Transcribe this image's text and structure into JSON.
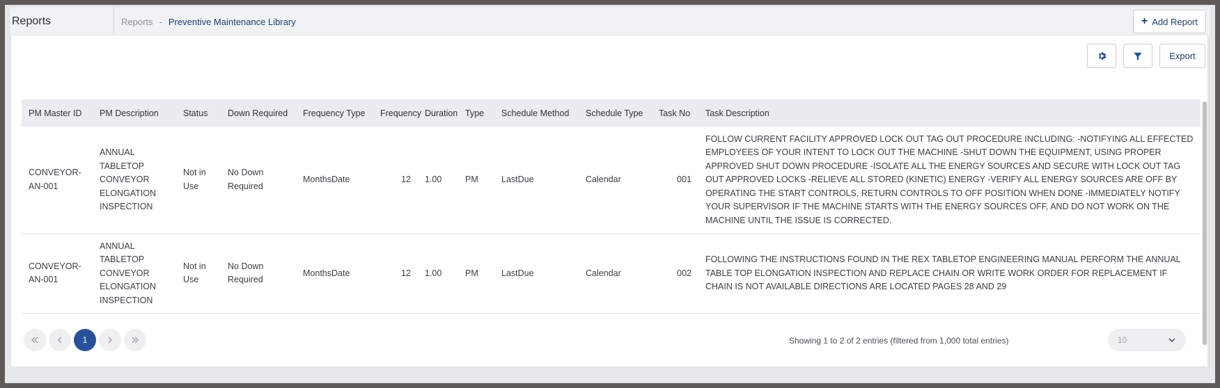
{
  "header": {
    "app_title": "Reports",
    "breadcrumb_root": "Reports",
    "breadcrumb_separator": "-",
    "breadcrumb_current": "Preventive Maintenance Library",
    "add_report_label": "Add Report"
  },
  "toolbar": {
    "export_label": "Export",
    "icons": [
      "gear-icon",
      "filter-icon"
    ]
  },
  "table": {
    "columns": [
      "PM Master ID",
      "PM Description",
      "Status",
      "Down Required",
      "Frequency Type",
      "Frequency",
      "Duration",
      "Type",
      "Schedule Method",
      "Schedule Type",
      "Task No",
      "Task Description"
    ],
    "rows": [
      {
        "pm_master_id": "CONVEYOR-AN-001",
        "pm_description": "ANNUAL TABLETOP CONVEYOR ELONGATION INSPECTION",
        "status": "Not in Use",
        "down_required": "No Down Required",
        "frequency_type": "MonthsDate",
        "frequency": "12",
        "duration": "1.00",
        "type": "PM",
        "schedule_method": "LastDue",
        "schedule_type": "Calendar",
        "task_no": "001",
        "task_description": "FOLLOW CURRENT FACILITY APPROVED LOCK OUT TAG OUT PROCEDURE INCLUDING: -NOTIFYING ALL EFFECTED EMPLOYEES OF YOUR INTENT TO LOCK OUT THE MACHINE -SHUT DOWN THE EQUIPMENT, USING PROPER APPROVED SHUT DOWN PROCEDURE -ISOLATE ALL THE ENERGY SOURCES AND SECURE WITH LOCK OUT TAG OUT APPROVED LOCKS -RELIEVE ALL STORED (KINETIC) ENERGY -VERIFY ALL ENERGY SOURCES ARE OFF BY OPERATING THE START CONTROLS, RETURN CONTROLS TO OFF POSITION WHEN DONE -IMMEDIATELY NOTIFY YOUR SUPERVISOR IF THE MACHINE STARTS WITH THE ENERGY SOURCES OFF, AND DO NOT WORK ON THE MACHINE UNTIL THE ISSUE IS CORRECTED."
      },
      {
        "pm_master_id": "CONVEYOR-AN-001",
        "pm_description": "ANNUAL TABLETOP CONVEYOR ELONGATION INSPECTION",
        "status": "Not in Use",
        "down_required": "No Down Required",
        "frequency_type": "MonthsDate",
        "frequency": "12",
        "duration": "1.00",
        "type": "PM",
        "schedule_method": "LastDue",
        "schedule_type": "Calendar",
        "task_no": "002",
        "task_description": "FOLLOWING THE INSTRUCTIONS FOUND IN THE REX TABLETOP ENGINEERING MANUAL PERFORM THE ANNUAL TABLE TOP ELONGATION INSPECTION AND REPLACE CHAIN OR WRITE WORK ORDER FOR REPLACEMENT IF CHAIN IS NOT AVAILABLE DIRECTIONS ARE LOCATED PAGES 28 AND 29"
      }
    ]
  },
  "pagination": {
    "current_page": "1",
    "info": "Showing 1 to 2 of 2 entries (filtered from 1,000 total entries)",
    "page_size": "10",
    "icons": [
      "first-page-icon",
      "prev-page-icon",
      "next-page-icon",
      "last-page-icon",
      "chevron-down-icon"
    ]
  },
  "colors": {
    "accent": "#27519a",
    "link": "#1f3f73",
    "header_row": "#ecebf2"
  }
}
